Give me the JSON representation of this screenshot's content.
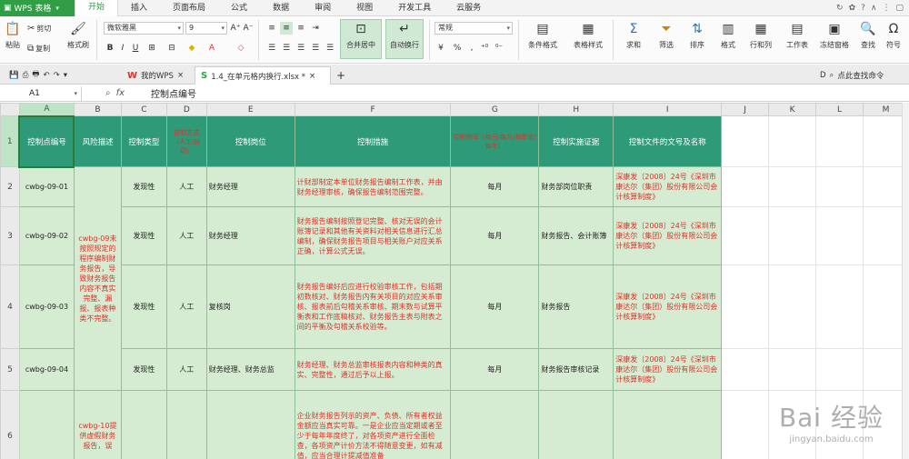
{
  "app": {
    "name": "WPS 表格"
  },
  "menu": {
    "tabs": [
      "开始",
      "插入",
      "页面布局",
      "公式",
      "数据",
      "审阅",
      "视图",
      "开发工具",
      "云服务"
    ],
    "active": "开始",
    "right_icons": [
      "↻",
      "✿",
      "?",
      "∧",
      "⋮",
      "▢"
    ]
  },
  "ribbon": {
    "paste": "粘贴",
    "cut": "剪切",
    "copy": "复制",
    "format_painter": "格式刷",
    "font_name": "微软雅黑",
    "font_size": "9",
    "merge_center": "合并居中",
    "auto_wrap": "自动换行",
    "number_format": "常规",
    "conditional_format": "条件格式",
    "table_style": "表格样式",
    "sum": "求和",
    "filter": "筛选",
    "sort": "排序",
    "format": "格式",
    "rows_cols": "行和列",
    "worksheet": "工作表",
    "freeze": "冻结窗格",
    "find": "查找",
    "symbol": "符号"
  },
  "tabs": {
    "my_wps": "我的WPS",
    "file": "1.4_在单元格内换行.xlsx *",
    "right_text": "点此查找命令"
  },
  "formula_bar": {
    "cell_ref": "A1",
    "fx": "fx",
    "content": "控制点编号"
  },
  "sheet": {
    "columns": [
      "A",
      "B",
      "C",
      "D",
      "E",
      "F",
      "G",
      "H",
      "I",
      "J",
      "K",
      "L",
      "M"
    ],
    "rows": [
      "1",
      "2",
      "3",
      "4",
      "5",
      "6"
    ],
    "header": {
      "a": "控制点编号",
      "b": "风险描述",
      "c": "控制类型",
      "d": "控制方式（人工/自动）",
      "e": "控制岗位",
      "f": "控制措施",
      "g": "控制频率（每日/每月/每季度/每年）",
      "h": "控制实施证据",
      "i": "控制文件的文号及名称"
    },
    "data": [
      {
        "a": "cwbg-09-01",
        "c": "发现性",
        "d": "人工",
        "e": "财务经理",
        "f": "计财部制定本单位财务报告编制工作表，并由财务经理审核，确保报告编制范围完整。",
        "g": "每月",
        "h": "财务部岗位职责",
        "i": "深康发〔2008〕24号《深圳市康达尔（集团）股份有限公司会计核算制度》"
      },
      {
        "a": "cwbg-09-02",
        "c": "发现性",
        "d": "人工",
        "e": "财务经理",
        "f": "财务报告编制按照登记完整、核对无误的会计账簿记录和其他有关资料对相关信息进行汇总编制，确保财务报告项目与相关账户对应关系正确，计算公式无误。",
        "g": "每月",
        "h": "财务报告、会计账簿",
        "i": "深康发〔2008〕24号《深圳市康达尔（集团）股份有限公司会计核算制度》"
      },
      {
        "a": "cwbg-09-03",
        "c": "发现性",
        "d": "人工",
        "e": "复核岗",
        "f": "财务报告编好后应进行校验审核工作，包括期初数核对、财务报告内有关项目的对应关系审核、报表前后勾稽关系审核、期末数与试算平衡表和工作底稿核对、财务报告主表与附表之间的平衡及勾稽关系校验等。",
        "g": "每月",
        "h": "财务报告",
        "i": "深康发〔2008〕24号《深圳市康达尔（集团）股份有限公司会计核算制度》"
      },
      {
        "a": "cwbg-09-04",
        "c": "发现性",
        "d": "人工",
        "e": "财务经理、财务总监",
        "f": "财务经理、财务总监审核报表内容和种类的真实、完整性，通过后予以上报。",
        "g": "每月",
        "h": "财务报告审核记录",
        "i": "深康发〔2008〕24号《深圳市康达尔（集团）股份有限公司会计核算制度》"
      },
      {
        "a": "",
        "c": "",
        "d": "",
        "e": "",
        "f": "企业财务报告列示的资产、负债、所有者权益金额应当真实可靠。一是企业应当定期或者至少于每年年度终了，对各项资产进行全面检查，各项资产计价方法不得随意变更，如有减值，应当合理计提减值准备",
        "g": "",
        "h": "",
        "i": ""
      }
    ],
    "b_merged_1": "cwbg-09未按照规定的程序编制财务报告，导致财务报告内容不真实完整、漏报、报表种类不完整。",
    "b_merged_2": "cwbg-10提供虚假财务报告，误"
  },
  "watermark": {
    "main": "Bai 经验",
    "sub": "jingyan.baidu.com"
  }
}
